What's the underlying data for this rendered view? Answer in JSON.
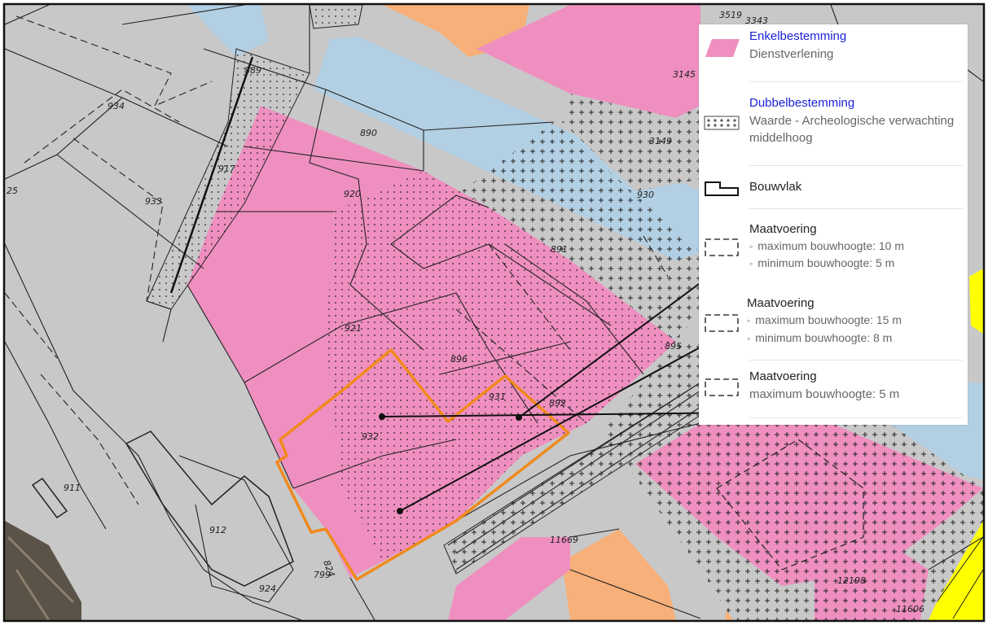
{
  "map": {
    "parcel_labels": [
      "934",
      "933",
      "25",
      "889",
      "890",
      "917",
      "920",
      "921",
      "896",
      "931",
      "892",
      "932",
      "891",
      "930",
      "895",
      "3519",
      "3343",
      "3145",
      "3149",
      "911",
      "912",
      "924",
      "799",
      "824",
      "11669",
      "12198",
      "11606"
    ]
  },
  "legend": {
    "enkel": {
      "title": "Enkelbestemming",
      "subtitle": "Dienstverlening",
      "swatch_color": "#ef8fc0"
    },
    "dubbel": {
      "title": "Dubbelbestemming",
      "line1": "Waarde - Archeologische verwachting",
      "line2": "middelhoog"
    },
    "bouwvlak": {
      "title": "Bouwvlak"
    },
    "maat1": {
      "title": "Maatvoering",
      "items": [
        "maximum bouwhoogte: 10 m",
        "minimum bouwhoogte: 5 m"
      ]
    },
    "maat2": {
      "title": "Maatvoering",
      "items": [
        "maximum bouwhoogte: 15 m",
        "minimum bouwhoogte: 8 m"
      ]
    },
    "maat3": {
      "title": "Maatvoering",
      "text": "maximum bouwhoogte: 5 m"
    }
  },
  "colors": {
    "pink": "#ef8fc0",
    "gray": "#c8c8c8",
    "blue": "#b3cfe3",
    "orange": "#f7b079",
    "yellow": "#ffff00",
    "highlight": "#f08a1c"
  },
  "icons": [
    "pink-swatch-icon",
    "cross-hatch-icon",
    "bouwvlak-icon",
    "dashed-rect-icon"
  ]
}
